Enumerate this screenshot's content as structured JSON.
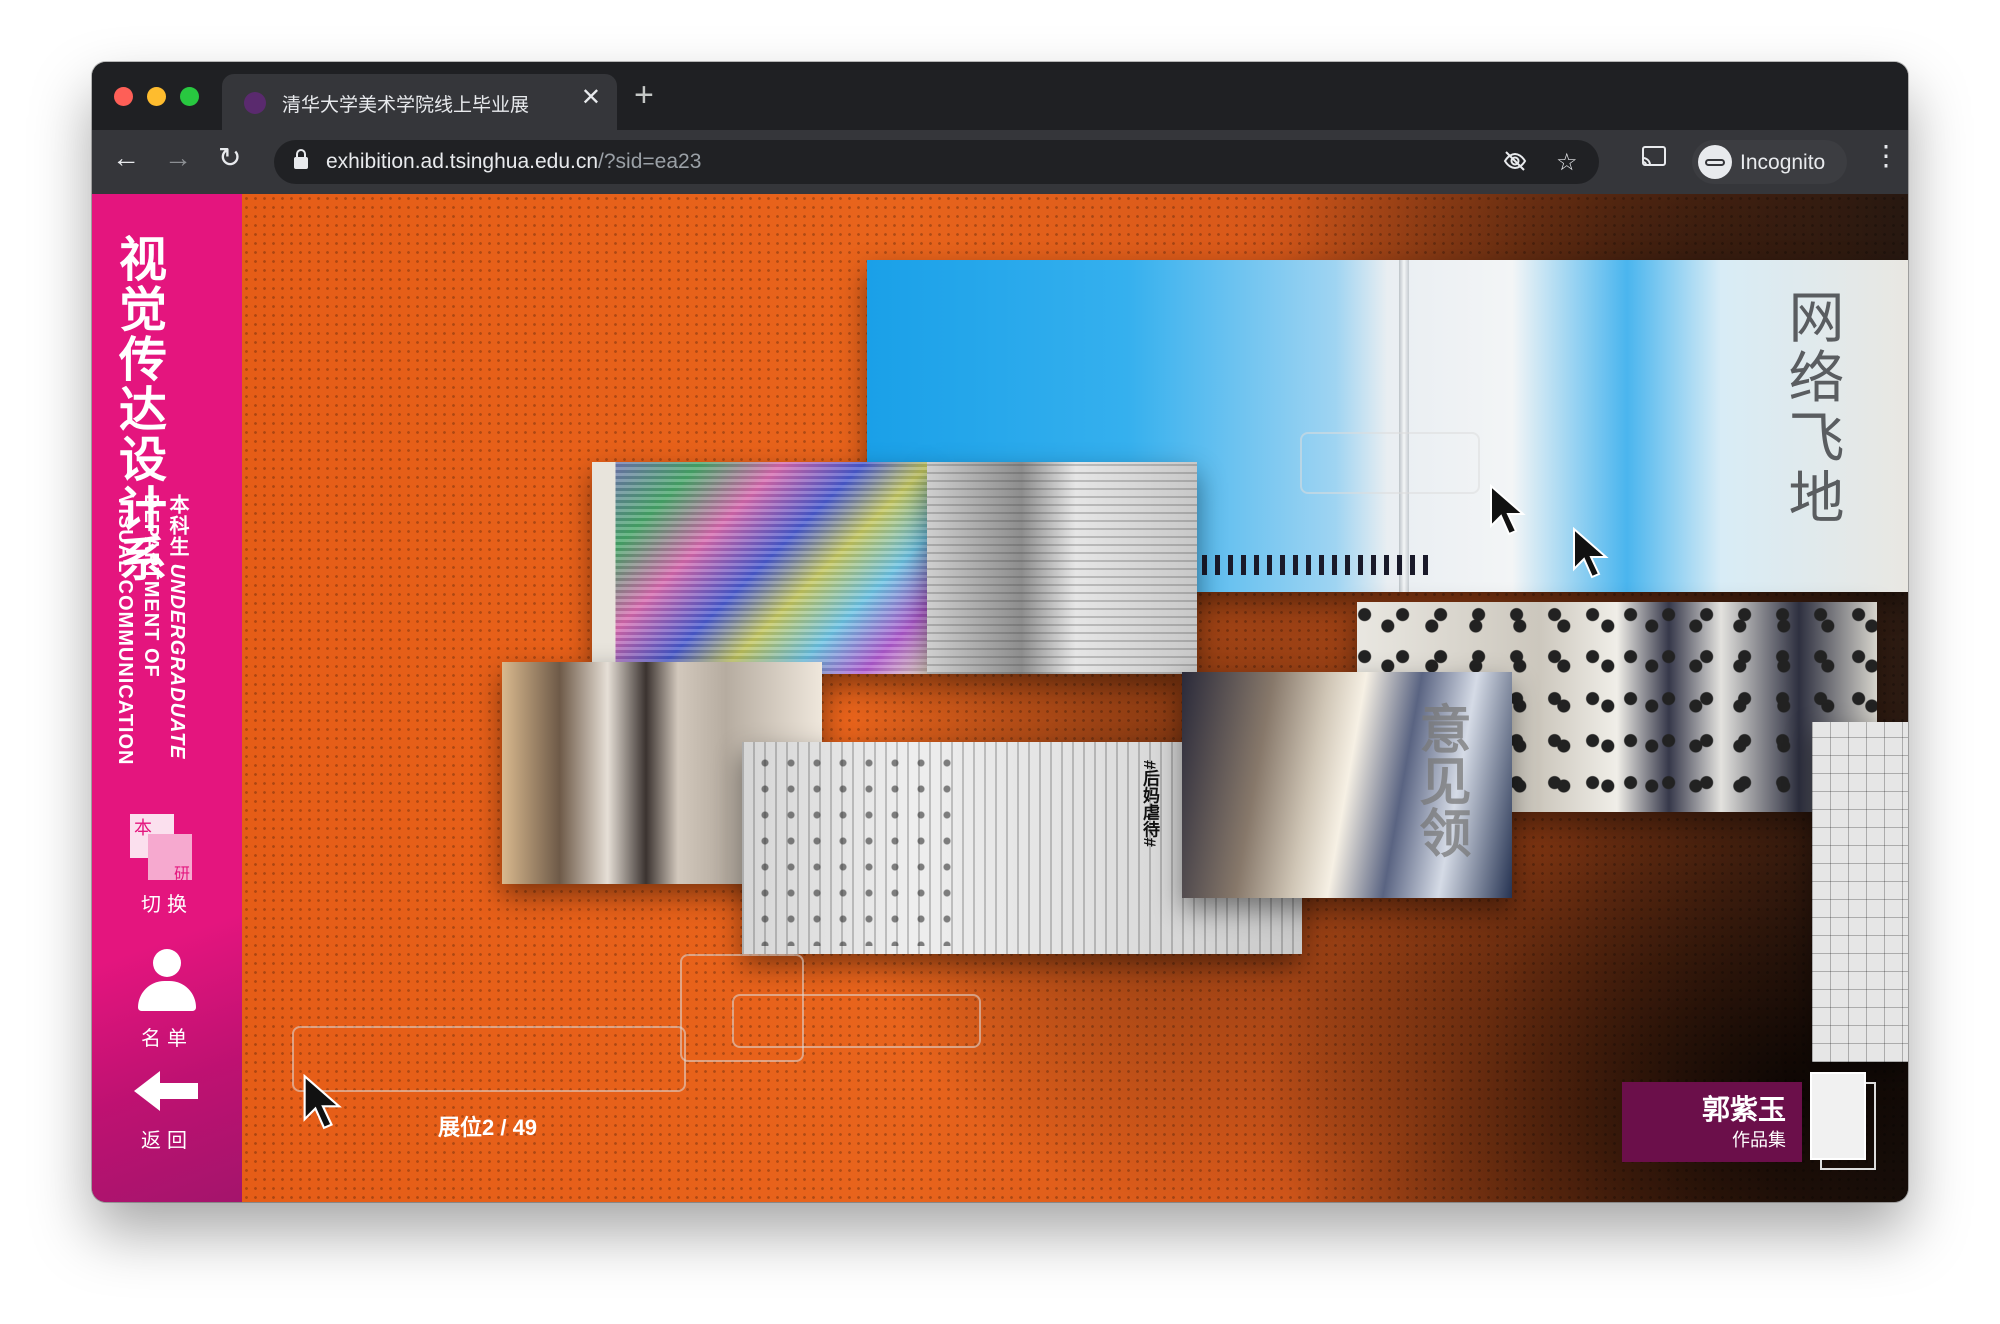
{
  "browser": {
    "tab_title": "清华大学美术学院线上毕业展",
    "tab_close": "✕",
    "new_tab": "+",
    "url_host": "exhibition.ad.tsinghua.edu.cn",
    "url_path": "/?sid=ea23",
    "profile_label": "Incognito"
  },
  "sidebar": {
    "dept_cn": "视觉传达设计系",
    "level_cn": "本科生",
    "level_en": "UNDERGRADUATE",
    "dept_en_1": "DEPARTMENT OF",
    "dept_en_2": "VISUAL COMMUNICATION",
    "switch_a": "本",
    "switch_b": "研",
    "switch_label": "切换",
    "list_label": "名单",
    "back_label": "返回"
  },
  "exhibit": {
    "counter": "展位2 / 49",
    "author_name": "郭紫玉",
    "author_sub": "作品集",
    "sky_title": "网络飞地",
    "hero_title": "意见领",
    "text_title": "#后妈虐待#"
  },
  "colors": {
    "sidebar": "#e4157e",
    "author_card": "#6b0f4a",
    "background_orange": "#e65d17"
  }
}
